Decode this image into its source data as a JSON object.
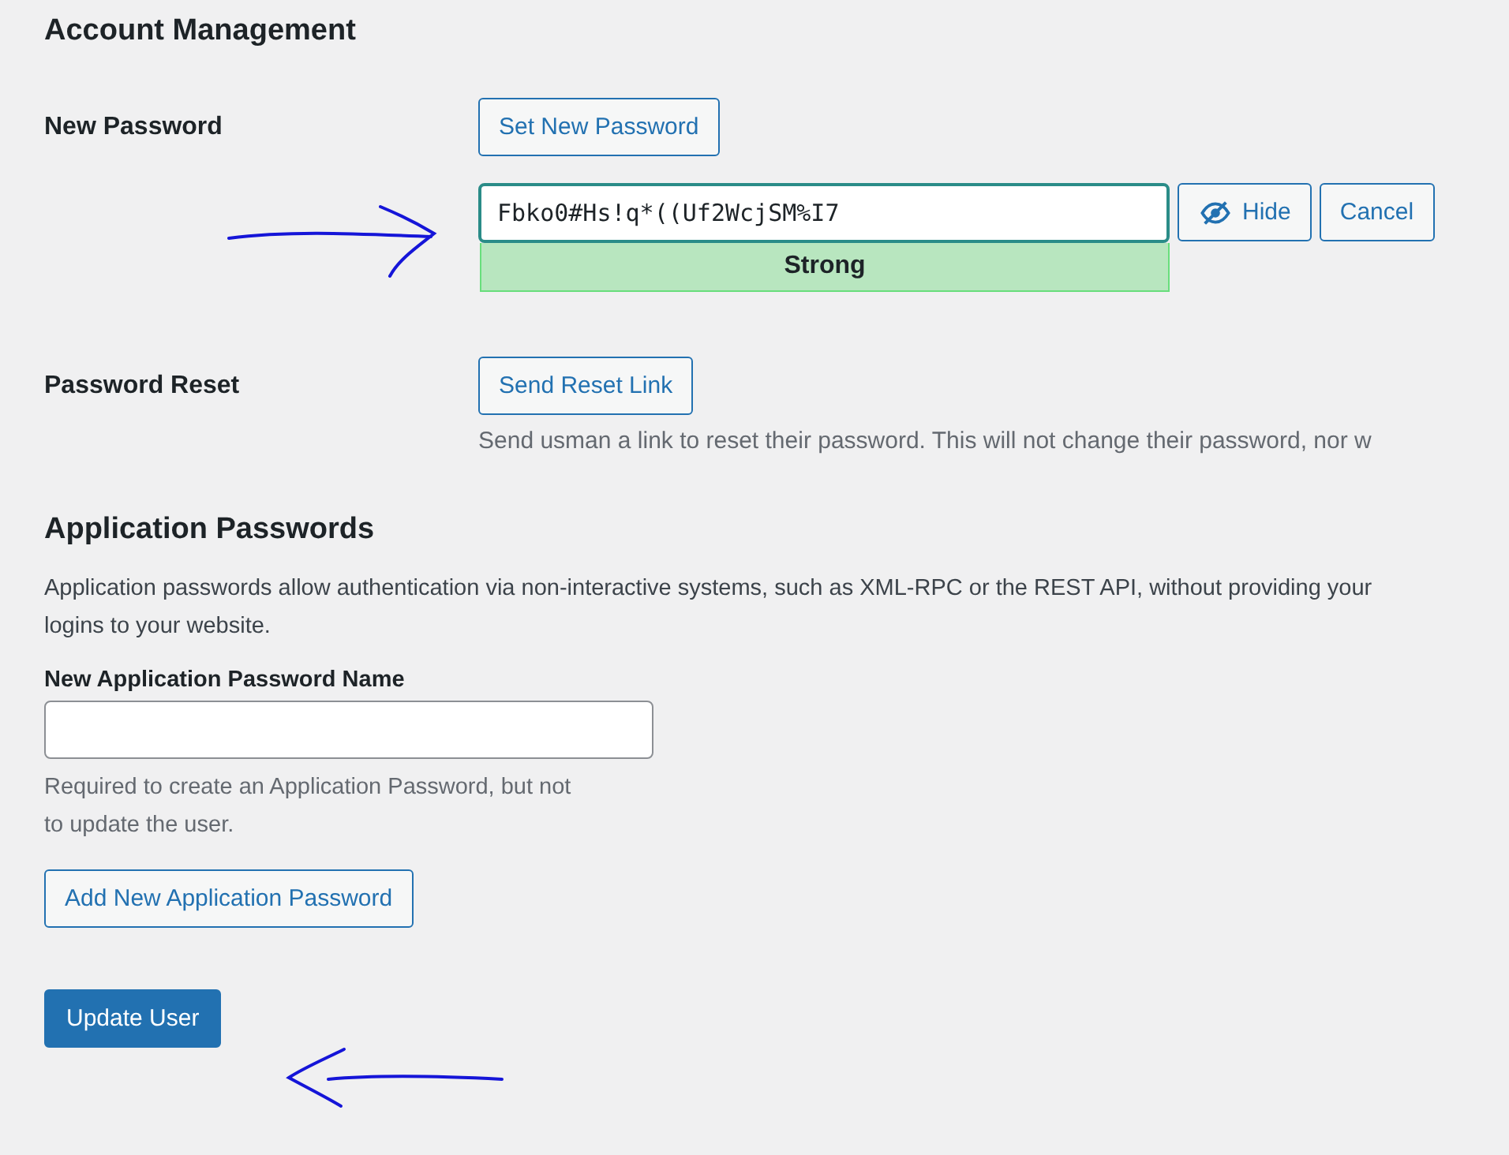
{
  "sections": [
    {
      "heading": "Account Management"
    },
    {
      "heading": "Application Passwords"
    }
  ],
  "new_password": {
    "label": "New Password",
    "set_button": "Set New Password",
    "value": "Fbko0#Hs!q*((Uf2WcjSM%I7",
    "strength": "Strong",
    "hide_button": "Hide",
    "cancel_button": "Cancel"
  },
  "password_reset": {
    "label": "Password Reset",
    "button": "Send Reset Link",
    "description": "Send usman a link to reset their password. This will not change their password, nor w"
  },
  "application_passwords": {
    "description": "Application passwords allow authentication via non-interactive systems, such as XML-RPC or the REST API, without providing your\nlogins to your website.",
    "name_label": "New Application Password Name",
    "help": "Required to create an Application Password, but not\nto update the user.",
    "add_button": "Add New Application Password"
  },
  "update_button": "Update User"
}
